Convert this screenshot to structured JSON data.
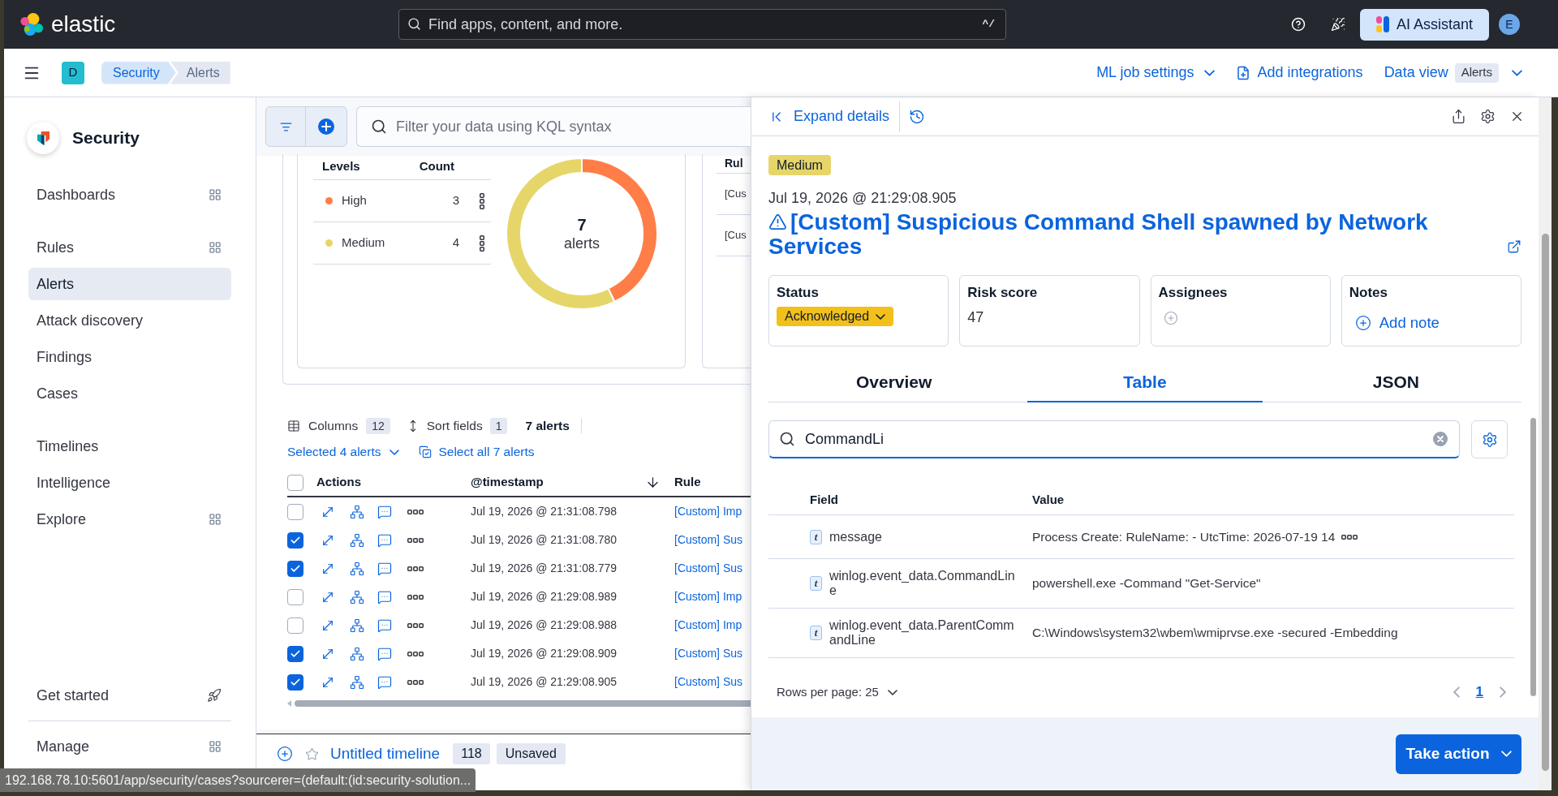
{
  "top_bar": {
    "logo_text": "elastic",
    "search": {
      "placeholder": "Find apps, content, and more.",
      "shortcut": "^/"
    },
    "assistant_button": "AI Assistant",
    "avatar": "E"
  },
  "header": {
    "space_badge": "D",
    "breadcrumbs": [
      {
        "label": "Security",
        "selected": false
      },
      {
        "label": "Alerts",
        "selected": true
      }
    ],
    "ml_job_settings": "ML job settings",
    "add_integrations": "Add integrations",
    "data_view": {
      "label": "Data view",
      "value": "Alerts"
    }
  },
  "sidebar": {
    "title": "Security",
    "groups": [
      [
        {
          "label": "Dashboards",
          "kind": "panel",
          "selected": false
        }
      ],
      [
        {
          "label": "Rules",
          "kind": "panel",
          "selected": false
        },
        {
          "label": "Alerts",
          "kind": "link",
          "selected": true
        },
        {
          "label": "Attack discovery",
          "kind": "link",
          "selected": false
        },
        {
          "label": "Findings",
          "kind": "link",
          "selected": false
        },
        {
          "label": "Cases",
          "kind": "link",
          "selected": false
        }
      ],
      [
        {
          "label": "Timelines",
          "kind": "link",
          "selected": false
        },
        {
          "label": "Intelligence",
          "kind": "link",
          "selected": false
        },
        {
          "label": "Explore",
          "kind": "panel",
          "selected": false
        }
      ]
    ],
    "footer": [
      {
        "label": "Get started",
        "kind": "launch",
        "selected": false
      },
      {
        "label": "Manage",
        "kind": "panel",
        "selected": false
      }
    ]
  },
  "query_bar": {
    "placeholder": "Filter your data using KQL syntax"
  },
  "severity_card": {
    "columns": [
      "Levels",
      "Count"
    ],
    "rows": [
      {
        "count": "3",
        "color": "#ff7e47"
      },
      {
        "count": "4",
        "color": "#e6d66a"
      }
    ],
    "total": "7",
    "total_label": "alerts",
    "chart_data": {
      "type": "donut",
      "categories": [
        "High",
        "Medium"
      ],
      "values": [
        42.86,
        57.14
      ]
    }
  },
  "rules_card": {
    "columns": [
      "Rul"
    ],
    "rows": [
      "[Cus",
      "[Cus"
    ]
  },
  "alerts_table": {
    "columns_button": {
      "label": "Columns",
      "count": "12"
    },
    "sort_button": {
      "label": "Sort fields",
      "count": "1"
    },
    "total": "7 alerts",
    "selected_menu": "Selected 4 alerts",
    "select_all": "Select all 7 alerts",
    "all_checked": false,
    "columns": [
      "Actions",
      "@timestamp",
      "Rule"
    ],
    "rows": [
      {
        "checked": false,
        "timestamp": "Jul 19, 2026 @ 21:31:08.798",
        "rule": "[Custom] Imp"
      },
      {
        "checked": true,
        "timestamp": "Jul 19, 2026 @ 21:31:08.780",
        "rule": "[Custom] Sus"
      },
      {
        "checked": true,
        "timestamp": "Jul 19, 2026 @ 21:31:08.779",
        "rule": "[Custom] Sus"
      },
      {
        "checked": false,
        "timestamp": "Jul 19, 2026 @ 21:29:08.989",
        "rule": "[Custom] Imp"
      },
      {
        "checked": false,
        "timestamp": "Jul 19, 2026 @ 21:29:08.988",
        "rule": "[Custom] Imp"
      },
      {
        "checked": true,
        "timestamp": "Jul 19, 2026 @ 21:29:08.909",
        "rule": "[Custom] Sus"
      },
      {
        "checked": true,
        "timestamp": "Jul 19, 2026 @ 21:29:08.905",
        "rule": "[Custom] Sus"
      }
    ]
  },
  "timeline": {
    "title": "Untitled timeline",
    "count": "118",
    "status": "Unsaved"
  },
  "flyout": {
    "expand": "Expand details",
    "severity": "Medium",
    "timestamp": "Jul 19, 2026 @ 21:29:08.905",
    "title": "[Custom] Suspicious Command Shell spawned by Network Services",
    "summary": [
      {
        "kind": "status",
        "label": "Status",
        "value": "Acknowledged"
      },
      {
        "kind": "score",
        "label": "Risk score",
        "value": "47"
      },
      {
        "kind": "assignees",
        "label": "Assignees"
      },
      {
        "kind": "notes",
        "label": "Notes",
        "action": "Add note"
      }
    ],
    "tabs": [
      {
        "label": "Overview",
        "selected": false
      },
      {
        "label": "Table",
        "selected": true
      },
      {
        "label": "JSON",
        "selected": false
      }
    ],
    "search": {
      "value": "CommandLi"
    },
    "fields": {
      "columns": [
        "Field",
        "Value"
      ],
      "rows": [
        {
          "type": "t",
          "field": "message",
          "value": "Process Create: RuleName: - UtcTime: 2026-07-19 14",
          "truncated": true
        },
        {
          "type": "t",
          "field": "winlog.event_data.CommandLine",
          "value": "powershell.exe -Command \"Get-Service\"",
          "truncated": false
        },
        {
          "type": "t",
          "field": "winlog.event_data.ParentCommandLine",
          "value": "C:\\Windows\\system32\\wbem\\wmiprvse.exe -secured -Embedding",
          "truncated": false
        }
      ]
    },
    "rows_per_page": "Rows per page: 25",
    "pages": [
      {
        "label": "1",
        "selected": true
      }
    ],
    "take_action": "Take action"
  },
  "status_url": "192.168.78.10:5601/app/security/cases?sourcerer=(default:(id:security-solution..."
}
